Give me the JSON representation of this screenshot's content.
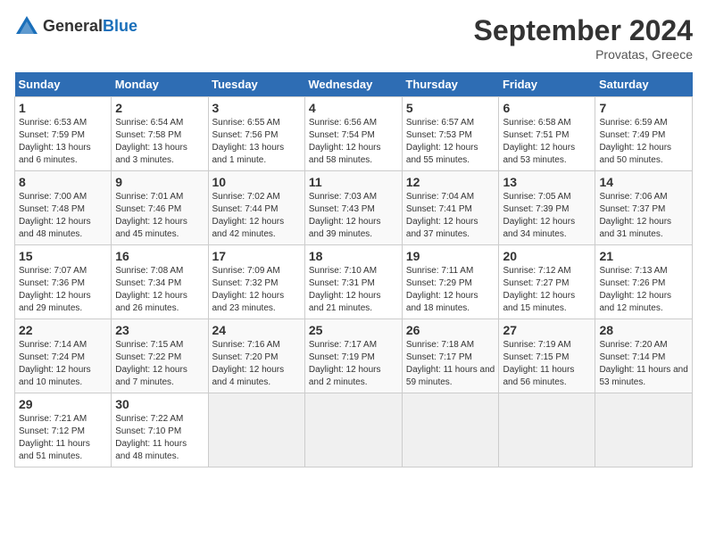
{
  "header": {
    "logo_general": "General",
    "logo_blue": "Blue",
    "month_title": "September 2024",
    "location": "Provatas, Greece"
  },
  "columns": [
    "Sunday",
    "Monday",
    "Tuesday",
    "Wednesday",
    "Thursday",
    "Friday",
    "Saturday"
  ],
  "weeks": [
    [
      {
        "day": "1",
        "sunrise": "6:53 AM",
        "sunset": "7:59 PM",
        "daylight": "13 hours and 6 minutes."
      },
      {
        "day": "2",
        "sunrise": "6:54 AM",
        "sunset": "7:58 PM",
        "daylight": "13 hours and 3 minutes."
      },
      {
        "day": "3",
        "sunrise": "6:55 AM",
        "sunset": "7:56 PM",
        "daylight": "13 hours and 1 minute."
      },
      {
        "day": "4",
        "sunrise": "6:56 AM",
        "sunset": "7:54 PM",
        "daylight": "12 hours and 58 minutes."
      },
      {
        "day": "5",
        "sunrise": "6:57 AM",
        "sunset": "7:53 PM",
        "daylight": "12 hours and 55 minutes."
      },
      {
        "day": "6",
        "sunrise": "6:58 AM",
        "sunset": "7:51 PM",
        "daylight": "12 hours and 53 minutes."
      },
      {
        "day": "7",
        "sunrise": "6:59 AM",
        "sunset": "7:49 PM",
        "daylight": "12 hours and 50 minutes."
      }
    ],
    [
      {
        "day": "8",
        "sunrise": "7:00 AM",
        "sunset": "7:48 PM",
        "daylight": "12 hours and 48 minutes."
      },
      {
        "day": "9",
        "sunrise": "7:01 AM",
        "sunset": "7:46 PM",
        "daylight": "12 hours and 45 minutes."
      },
      {
        "day": "10",
        "sunrise": "7:02 AM",
        "sunset": "7:44 PM",
        "daylight": "12 hours and 42 minutes."
      },
      {
        "day": "11",
        "sunrise": "7:03 AM",
        "sunset": "7:43 PM",
        "daylight": "12 hours and 39 minutes."
      },
      {
        "day": "12",
        "sunrise": "7:04 AM",
        "sunset": "7:41 PM",
        "daylight": "12 hours and 37 minutes."
      },
      {
        "day": "13",
        "sunrise": "7:05 AM",
        "sunset": "7:39 PM",
        "daylight": "12 hours and 34 minutes."
      },
      {
        "day": "14",
        "sunrise": "7:06 AM",
        "sunset": "7:37 PM",
        "daylight": "12 hours and 31 minutes."
      }
    ],
    [
      {
        "day": "15",
        "sunrise": "7:07 AM",
        "sunset": "7:36 PM",
        "daylight": "12 hours and 29 minutes."
      },
      {
        "day": "16",
        "sunrise": "7:08 AM",
        "sunset": "7:34 PM",
        "daylight": "12 hours and 26 minutes."
      },
      {
        "day": "17",
        "sunrise": "7:09 AM",
        "sunset": "7:32 PM",
        "daylight": "12 hours and 23 minutes."
      },
      {
        "day": "18",
        "sunrise": "7:10 AM",
        "sunset": "7:31 PM",
        "daylight": "12 hours and 21 minutes."
      },
      {
        "day": "19",
        "sunrise": "7:11 AM",
        "sunset": "7:29 PM",
        "daylight": "12 hours and 18 minutes."
      },
      {
        "day": "20",
        "sunrise": "7:12 AM",
        "sunset": "7:27 PM",
        "daylight": "12 hours and 15 minutes."
      },
      {
        "day": "21",
        "sunrise": "7:13 AM",
        "sunset": "7:26 PM",
        "daylight": "12 hours and 12 minutes."
      }
    ],
    [
      {
        "day": "22",
        "sunrise": "7:14 AM",
        "sunset": "7:24 PM",
        "daylight": "12 hours and 10 minutes."
      },
      {
        "day": "23",
        "sunrise": "7:15 AM",
        "sunset": "7:22 PM",
        "daylight": "12 hours and 7 minutes."
      },
      {
        "day": "24",
        "sunrise": "7:16 AM",
        "sunset": "7:20 PM",
        "daylight": "12 hours and 4 minutes."
      },
      {
        "day": "25",
        "sunrise": "7:17 AM",
        "sunset": "7:19 PM",
        "daylight": "12 hours and 2 minutes."
      },
      {
        "day": "26",
        "sunrise": "7:18 AM",
        "sunset": "7:17 PM",
        "daylight": "11 hours and 59 minutes."
      },
      {
        "day": "27",
        "sunrise": "7:19 AM",
        "sunset": "7:15 PM",
        "daylight": "11 hours and 56 minutes."
      },
      {
        "day": "28",
        "sunrise": "7:20 AM",
        "sunset": "7:14 PM",
        "daylight": "11 hours and 53 minutes."
      }
    ],
    [
      {
        "day": "29",
        "sunrise": "7:21 AM",
        "sunset": "7:12 PM",
        "daylight": "11 hours and 51 minutes."
      },
      {
        "day": "30",
        "sunrise": "7:22 AM",
        "sunset": "7:10 PM",
        "daylight": "11 hours and 48 minutes."
      },
      null,
      null,
      null,
      null,
      null
    ]
  ]
}
